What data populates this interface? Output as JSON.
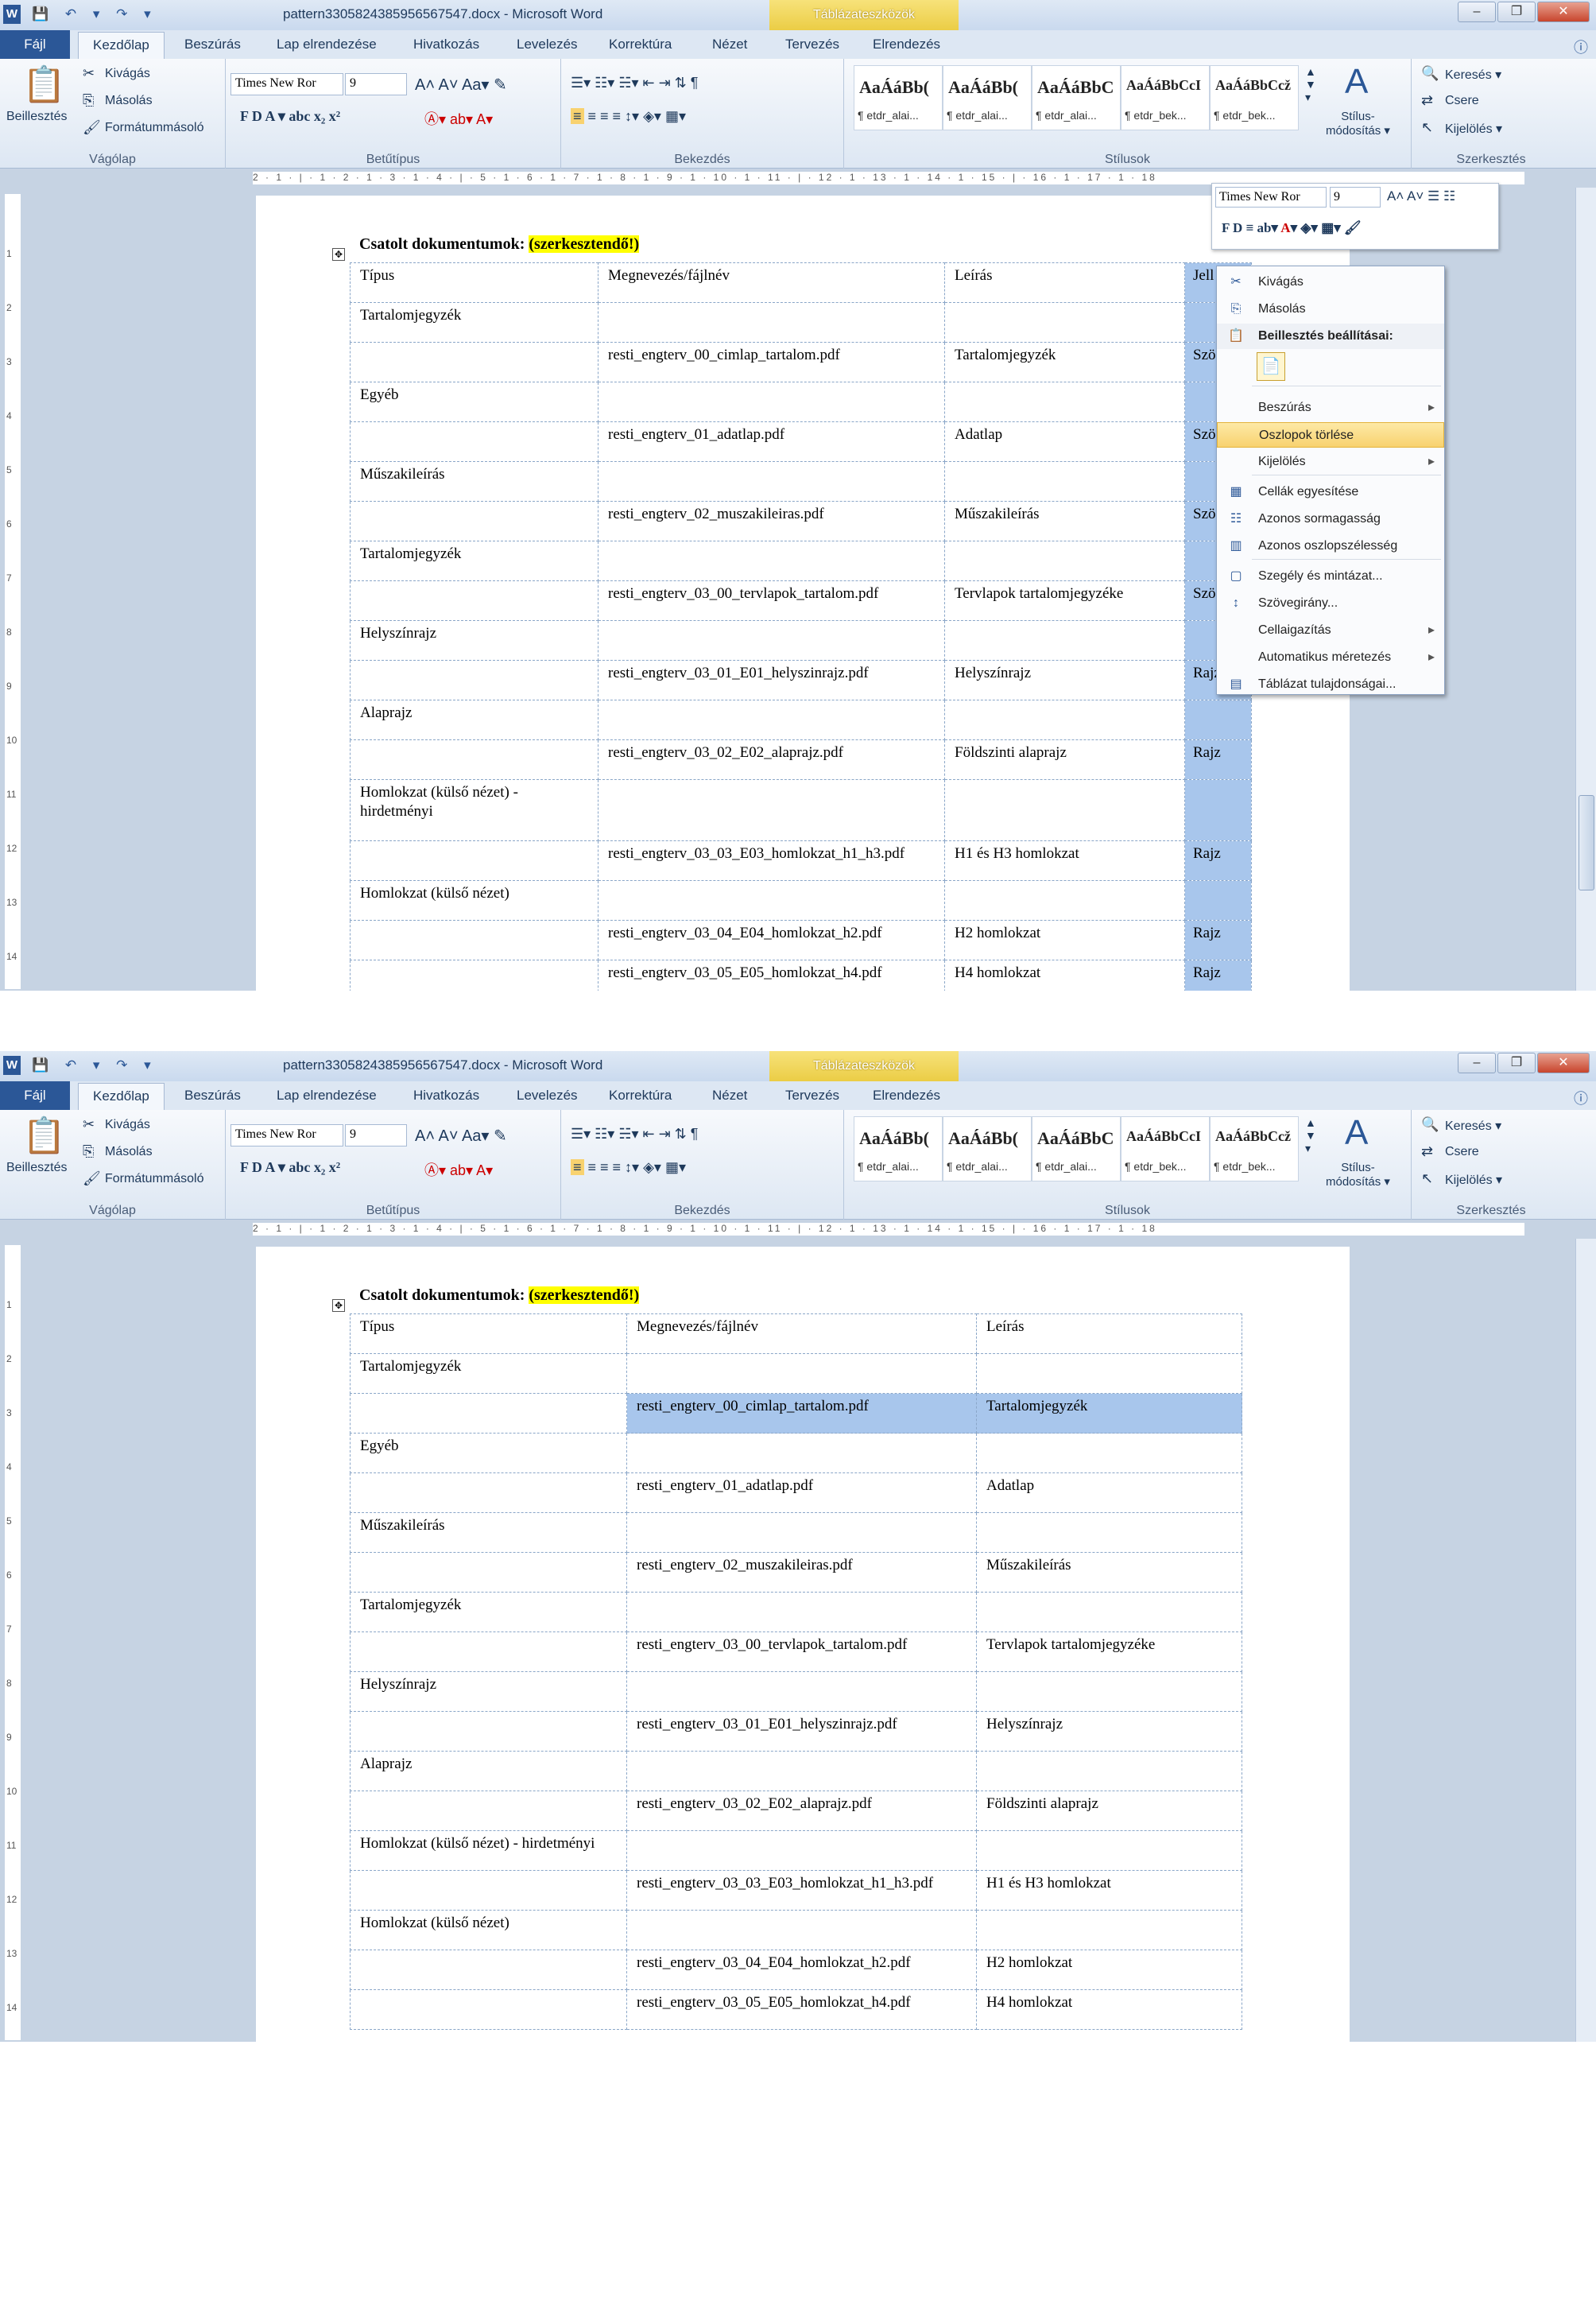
{
  "window": {
    "title": "pattern3305824385956567547.docx - Microsoft Word",
    "context_tab": "Táblázateszközök",
    "quick_access": "💾 ↶ ▾ ↷ ▾"
  },
  "tabs": [
    "Fájl",
    "Kezdőlap",
    "Beszúrás",
    "Lap elrendezése",
    "Hivatkozás",
    "Levelezés",
    "Korrektúra",
    "Nézet",
    "Tervezés",
    "Elrendezés"
  ],
  "ribbon": {
    "clipboard": {
      "paste": "Beillesztés",
      "cut": "Kivágás",
      "copy": "Másolás",
      "format_painter": "Formátummásoló",
      "group": "Vágólap"
    },
    "font": {
      "name": "Times New Ror",
      "size": "9",
      "group": "Betűtípus",
      "buttons": "F   D   A ▾   abc   x₂   x²"
    },
    "paragraph": {
      "group": "Bekezdés"
    },
    "styles": {
      "group": "Stílusok",
      "items": [
        {
          "sample": "AaÁáBb(",
          "name": "¶ etdr_alai..."
        },
        {
          "sample": "AaÁáBb(",
          "name": "¶ etdr_alai..."
        },
        {
          "sample": "AaÁáBbC",
          "name": "¶ etdr_alai..."
        },
        {
          "sample": "AaÁáBbCcI",
          "name": "¶ etdr_bek..."
        },
        {
          "sample": "AaÁáBbCcž",
          "name": "¶ etdr_bek..."
        }
      ],
      "change": "Stílus-\nmódosítás ▾"
    },
    "editing": {
      "find": "Keresés ▾",
      "replace": "Csere",
      "select": "Kijelölés ▾",
      "group": "Szerkesztés"
    }
  },
  "ruler_text": "2 · 1 · | · 1 · 2 · 1 · 3 · 1 · 4 · | · 5 · 1 · 6 · 1 · 7 · 1 · 8 · 1 · 9 · 1 · 10 · 1 · 11 · | · 12 · 1 · 13 · 1 · 14 · 1 · 15 · | · 16 · 1 · 17 · 1 · 18",
  "document": {
    "heading": "Csatolt dokumentumok:",
    "heading_highlight": "(szerkesztendő!)",
    "header_row": [
      "Típus",
      "Megnevezés/fájlnév",
      "Leírás",
      "Jell"
    ],
    "rows": [
      [
        "Tartalomjegyzék",
        "",
        "",
        ""
      ],
      [
        "",
        "resti_engterv_00_cimlap_tartalom.pdf",
        "Tartalomjegyzék",
        "Szö"
      ],
      [
        "Egyéb",
        "",
        "",
        ""
      ],
      [
        "",
        "resti_engterv_01_adatlap.pdf",
        "Adatlap",
        "Szö"
      ],
      [
        "Műszakileírás",
        "",
        "",
        ""
      ],
      [
        "",
        "resti_engterv_02_muszakileiras.pdf",
        "Műszakileírás",
        "Szö"
      ],
      [
        "Tartalomjegyzék",
        "",
        "",
        ""
      ],
      [
        "",
        "resti_engterv_03_00_tervlapok_tartalom.pdf",
        "Tervlapok tartalomjegyzéke",
        "Szö"
      ],
      [
        "Helyszínrajz",
        "",
        "",
        ""
      ],
      [
        "",
        "resti_engterv_03_01_E01_helyszinrajz.pdf",
        "Helyszínrajz",
        "Rajz"
      ],
      [
        "Alaprajz",
        "",
        "",
        ""
      ],
      [
        "",
        "resti_engterv_03_02_E02_alaprajz.pdf",
        "Földszinti alaprajz",
        "Rajz"
      ],
      [
        "Homlokzat (külső nézet) - hirdetményi",
        "",
        "",
        ""
      ],
      [
        "",
        "resti_engterv_03_03_E03_homlokzat_h1_h3.pdf",
        "H1 és H3 homlokzat",
        "Rajz"
      ],
      [
        "Homlokzat (külső nézet)",
        "",
        "",
        ""
      ],
      [
        "",
        "resti_engterv_03_04_E04_homlokzat_h2.pdf",
        "H2 homlokzat",
        "Rajz"
      ],
      [
        "",
        "resti_engterv_03_05_E05_homlokzat_h4.pdf",
        "H4 homlokzat",
        "Rajz"
      ]
    ]
  },
  "mini_toolbar": {
    "font": "Times New Ror",
    "size": "9"
  },
  "context_menu": [
    {
      "label": "Kivágás",
      "icon": "✂"
    },
    {
      "label": "Másolás",
      "icon": "⎘"
    },
    {
      "label": "Beillesztés beállításai:",
      "icon": "📋"
    },
    {
      "label": "Beszúrás",
      "icon": "",
      "sub": true
    },
    {
      "label": "Oszlopok törlése",
      "icon": ""
    },
    {
      "label": "Kijelölés",
      "icon": "",
      "sub": true
    },
    {
      "label": "Cellák egyesítése",
      "icon": "▦"
    },
    {
      "label": "Azonos sormagasság",
      "icon": "☷"
    },
    {
      "label": "Azonos oszlopszélesség",
      "icon": "▥"
    },
    {
      "label": "Szegély és mintázat...",
      "icon": "▢"
    },
    {
      "label": "Szövegirány...",
      "icon": "↕"
    },
    {
      "label": "Cellaigazítás",
      "icon": "",
      "sub": true
    },
    {
      "label": "Automatikus méretezés",
      "icon": "",
      "sub": true
    },
    {
      "label": "Táblázat tulajdonságai...",
      "icon": "▤"
    }
  ]
}
